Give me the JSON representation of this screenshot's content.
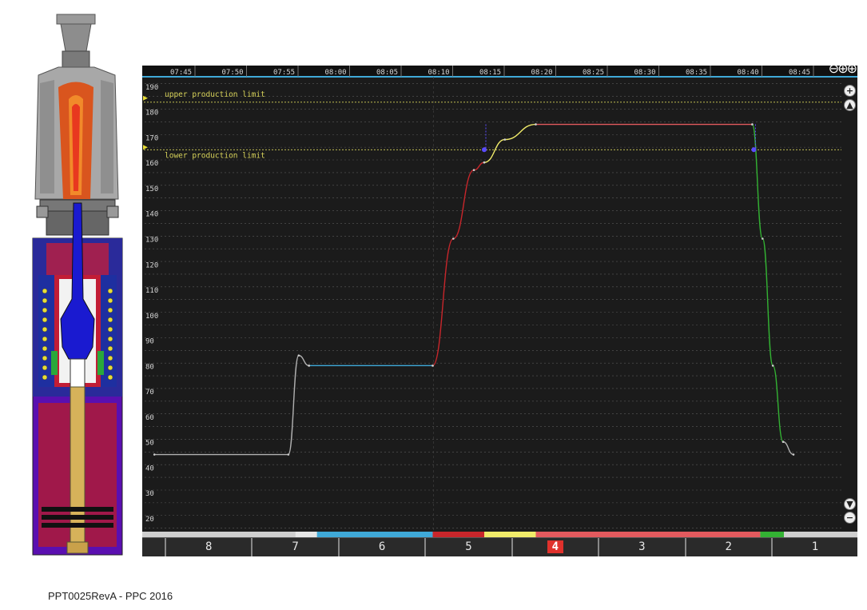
{
  "footer": "PPT0025RevA - PPC 2016",
  "monitor": {
    "time_ticks": [
      "07:45",
      "07:50",
      "07:55",
      "08:00",
      "08:05",
      "08:10",
      "08:15",
      "08:20",
      "08:25",
      "08:30",
      "08:35",
      "08:40",
      "08:45"
    ],
    "y_ticks": [
      190,
      180,
      170,
      160,
      150,
      140,
      130,
      120,
      110,
      100,
      90,
      80,
      70,
      60,
      50,
      40,
      30,
      20
    ],
    "upper_limit_label": "upper production limit",
    "lower_limit_label": "lower production limit",
    "zoom_in_icon": "zoom-in-icon",
    "zoom_out_icon": "zoom-out-icon",
    "steps": [
      {
        "label": "",
        "active": false
      },
      {
        "label": "8",
        "active": false
      },
      {
        "label": "7",
        "active": false
      },
      {
        "label": "6",
        "active": false
      },
      {
        "label": "5",
        "active": false
      },
      {
        "label": "4",
        "active": true
      },
      {
        "label": "3",
        "active": false
      },
      {
        "label": "2",
        "active": false
      },
      {
        "label": "1",
        "active": false
      }
    ],
    "phase_colors": [
      "#e6e6e6",
      "#3fa9d8",
      "#c8262b",
      "#f1ec6a",
      "#e35a5e",
      "#33b233"
    ]
  },
  "chart_data": {
    "type": "line",
    "xlabel": "",
    "ylabel": "",
    "ylim": [
      14,
      195
    ],
    "upper_production_limit": 185,
    "lower_production_limit": 165,
    "series": [
      {
        "color": "#b0b0b0",
        "points": [
          [
            "07:43",
            45
          ],
          [
            "07:56",
            45
          ],
          [
            "07:57",
            84
          ],
          [
            "07:58",
            80
          ]
        ]
      },
      {
        "color": "#3fa9d8",
        "points": [
          [
            "07:58",
            80
          ],
          [
            "08:10",
            80
          ]
        ]
      },
      {
        "color": "#c8262b",
        "points": [
          [
            "08:10",
            80
          ],
          [
            "08:12",
            130
          ],
          [
            "08:14",
            157
          ],
          [
            "08:15",
            160
          ]
        ]
      },
      {
        "color": "#f1ec6a",
        "points": [
          [
            "08:15",
            160
          ],
          [
            "08:17",
            169
          ],
          [
            "08:20",
            175
          ]
        ]
      },
      {
        "color": "#e35a5e",
        "points": [
          [
            "08:20",
            175
          ],
          [
            "08:41",
            175
          ]
        ]
      },
      {
        "color": "#33b233",
        "points": [
          [
            "08:41",
            175
          ],
          [
            "08:42",
            130
          ],
          [
            "08:43",
            80
          ],
          [
            "08:44",
            50
          ]
        ]
      },
      {
        "color": "#b0b0b0",
        "points": [
          [
            "08:44",
            50
          ],
          [
            "08:45",
            45
          ]
        ]
      }
    ]
  }
}
